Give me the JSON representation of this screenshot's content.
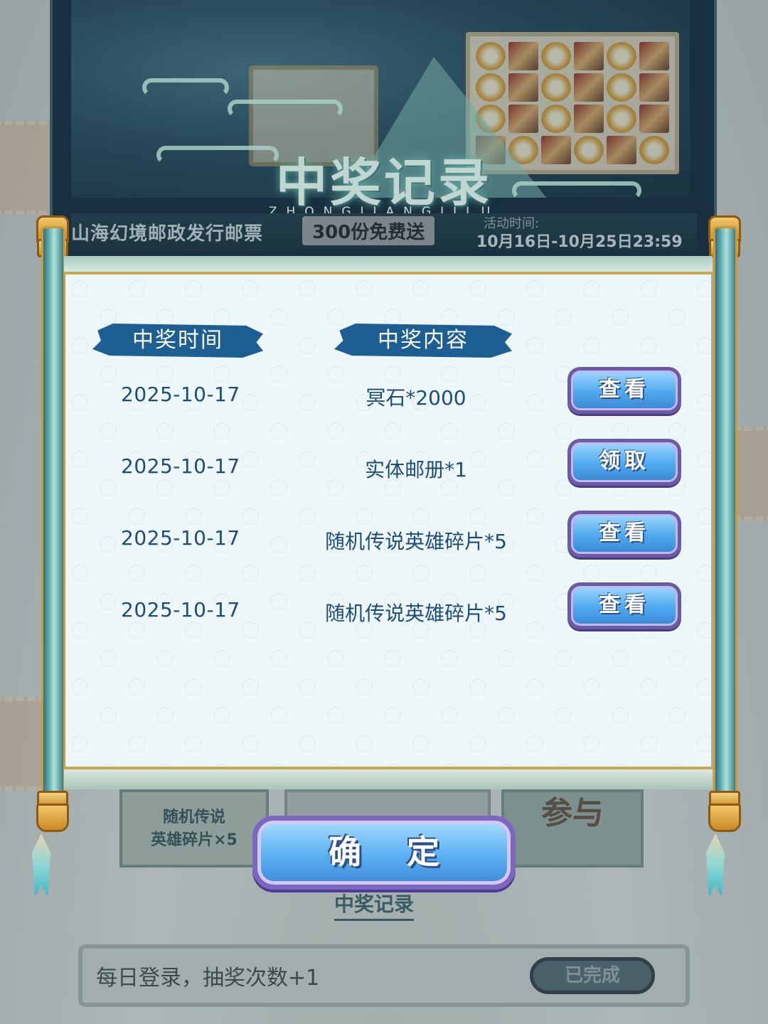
{
  "banner": {
    "title": "中奖记录",
    "subtitle": "ZHONGJIANGJILU",
    "event_name": "山海幻境邮政发行邮票",
    "event_badge": "300份免费送",
    "time_label": "活动时间:",
    "time_range": "10月16日-10月25日23:59"
  },
  "modal": {
    "headers": {
      "time": "中奖时间",
      "content": "中奖内容"
    },
    "records": [
      {
        "date": "2025-10-17",
        "content": "冥石*2000",
        "action": "查看"
      },
      {
        "date": "2025-10-17",
        "content": "实体邮册*1",
        "action": "领取"
      },
      {
        "date": "2025-10-17",
        "content": "随机传说英雄碎片*5",
        "action": "查看"
      },
      {
        "date": "2025-10-17",
        "content": "随机传说英雄碎片*5",
        "action": "查看"
      }
    ],
    "confirm_label": "确 定"
  },
  "background": {
    "prize_label_line1": "随机传说",
    "prize_label_line2": "英雄碎片×5",
    "join_label": "参与",
    "record_link": "中奖记录",
    "task_text": "每日登录，抽奖次数+1",
    "task_status": "已完成"
  },
  "colors": {
    "header_bg": "#1e5f93",
    "text_primary": "#1d4c78",
    "button_blue": "#4fa8ef",
    "button_border": "#6b5aa6"
  }
}
